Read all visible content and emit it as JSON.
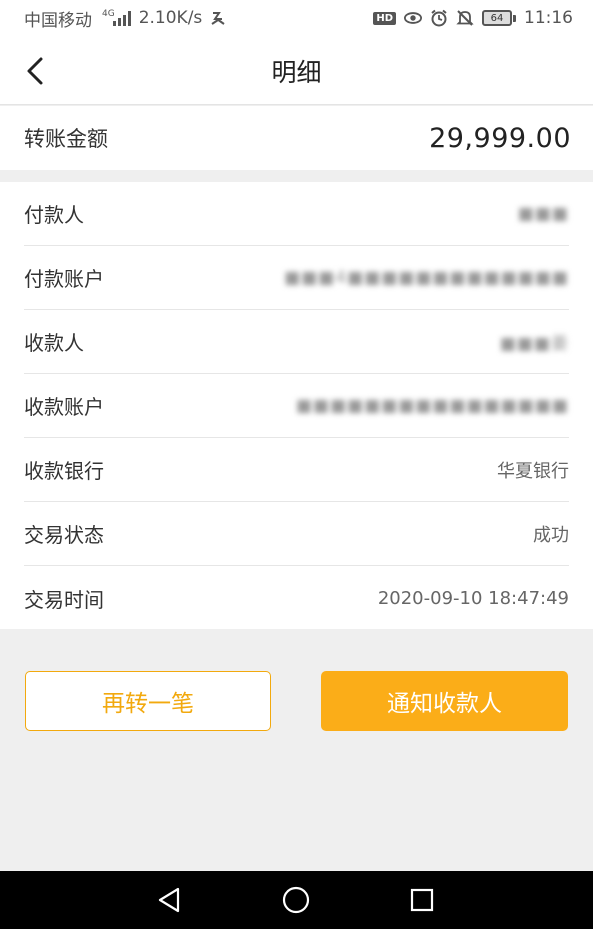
{
  "status_bar": {
    "carrier": "中国移动",
    "network_type": "4G",
    "speed": "2.10K/s",
    "time": "11:16",
    "hd_badge": "HD",
    "battery": "64",
    "icons": [
      "signal-icon",
      "data-usage-icon",
      "eye-icon",
      "alarm-icon",
      "mute-icon",
      "battery-icon"
    ]
  },
  "header": {
    "title": "明细",
    "back_icon": "chevron-left-icon"
  },
  "amount": {
    "label": "转账金额",
    "value": "29,999.00"
  },
  "details": [
    {
      "label": "付款人",
      "value": "■■■",
      "obscured": true
    },
    {
      "label": "付款账户",
      "value": "■■■4■■■■■■■■■■■■■",
      "obscured": true
    },
    {
      "label": "收款人",
      "value": "■■■姜",
      "obscured": true
    },
    {
      "label": "收款账户",
      "value": "■■■■■■■■■■■■■■■■",
      "obscured": true
    },
    {
      "label": "收款银行",
      "value": "华夏银行",
      "obscured": false
    },
    {
      "label": "交易状态",
      "value": "成功",
      "obscured": false
    },
    {
      "label": "交易时间",
      "value": "2020-09-10 18:47:49",
      "obscured": false
    }
  ],
  "actions": {
    "again_label": "再转一笔",
    "notify_label": "通知收款人"
  },
  "colors": {
    "accent": "#fbad18",
    "accent_border": "#f2a90e",
    "background": "#efefef"
  }
}
